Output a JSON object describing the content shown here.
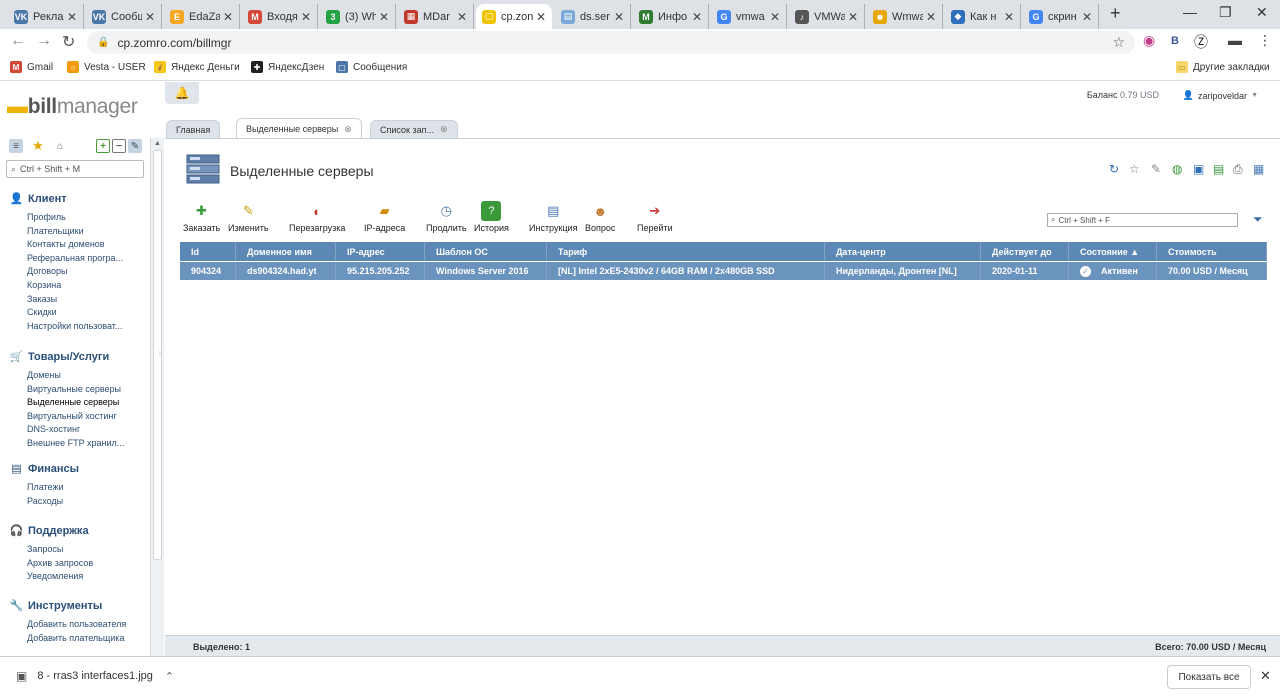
{
  "browser": {
    "tabs": [
      {
        "label": "Рекла",
        "fav": "VK",
        "color": "#4a76a8"
      },
      {
        "label": "Сообщ",
        "fav": "VK",
        "color": "#4a76a8"
      },
      {
        "label": "EdaZa",
        "fav": "E",
        "color": "#f5a623"
      },
      {
        "label": "Входя",
        "fav": "M",
        "color": "#d44638"
      },
      {
        "label": "(3) Wh",
        "fav": "3",
        "color": "#25a244"
      },
      {
        "label": "MDar",
        "fav": "▦",
        "color": "#c0392b"
      },
      {
        "label": "cp.zon",
        "fav": "▢",
        "color": "#f0c400"
      },
      {
        "label": "ds.ser",
        "fav": "▤",
        "color": "#7aa7d8"
      },
      {
        "label": "Инфо",
        "fav": "M",
        "color": "#2e7d32"
      },
      {
        "label": "vmwa",
        "fav": "G",
        "color": "#4285f4"
      },
      {
        "label": "VMWa",
        "fav": "♪",
        "color": "#555555"
      },
      {
        "label": "Wmwa",
        "fav": "☻",
        "color": "#e6a700"
      },
      {
        "label": "Как н",
        "fav": "◆",
        "color": "#2f6ebd"
      },
      {
        "label": "скрин",
        "fav": "G",
        "color": "#4285f4"
      }
    ],
    "url": "cp.zomro.com/billmgr",
    "bookmarks": [
      {
        "label": "Gmail",
        "fav": "M",
        "color": "#d44638"
      },
      {
        "label": "Vesta - USER",
        "fav": "○",
        "color": "#f39c12"
      },
      {
        "label": "Яндекс Деньги",
        "fav": "💰",
        "color": "#f5c518"
      },
      {
        "label": "ЯндексДзен",
        "fav": "✚",
        "color": "#222222"
      },
      {
        "label": "Сообщения",
        "fav": "▢",
        "color": "#4a76a8"
      }
    ],
    "other_bookmarks": "Другие закладки"
  },
  "app": {
    "logo_bill": "bill",
    "logo_manager": "manager",
    "balance_label": "Баланс",
    "balance_value": "0.79 USD",
    "username": "zaripoveldar",
    "sidebar_search_placeholder": "Ctrl + Shift + M",
    "sections": [
      {
        "title": "Клиент",
        "items": [
          "Профиль",
          "Плательщики",
          "Контакты доменов",
          "Реферальная програ...",
          "Договоры",
          "Корзина",
          "Заказы",
          "Скидки",
          "Настройки пользоват..."
        ]
      },
      {
        "title": "Товары/Услуги",
        "items": [
          "Домены",
          "Виртуальные серверы",
          "Выделенные серверы",
          "Виртуальный хостинг",
          "DNS-хостинг",
          "Внешнее FTP хранил..."
        ]
      },
      {
        "title": "Финансы",
        "items": [
          "Платежи",
          "Расходы"
        ]
      },
      {
        "title": "Поддержка",
        "items": [
          "Запросы",
          "Архив запросов",
          "Уведомления"
        ]
      },
      {
        "title": "Инструменты",
        "items": [
          "Добавить пользователя",
          "Добавить плательщика"
        ]
      }
    ],
    "app_tabs": [
      "Главная",
      "Выделенные серверы",
      "Список зап..."
    ],
    "page_title": "Выделенные серверы",
    "toolbar": [
      "Заказать",
      "Изменить",
      "Перезагрузка",
      "IP-адреса",
      "Продлить",
      "История",
      "Инструкция",
      "Вопрос",
      "Перейти"
    ],
    "filter_placeholder": "Ctrl + Shift + F",
    "columns": [
      "Id",
      "Доменное имя",
      "IP-адрес",
      "Шаблон ОС",
      "Тариф",
      "Дата-центр",
      "Действует до",
      "Состояние ▲",
      "Стоимость"
    ],
    "rows": [
      [
        "904324",
        "ds904324.had.yt",
        "95.215.205.252",
        "Windows Server 2016",
        "[NL] Intel 2xE5-2430v2 / 64GB RAM / 2x480GB SSD",
        "Нидерланды, Дронтен [NL]",
        "2020-01-11",
        "Активен",
        "70.00 USD / Месяц"
      ]
    ],
    "selected_label": "Выделено: 1",
    "total_label": "Всего: 70.00 USD / Месяц"
  },
  "download": {
    "filename": "8 - rras3 interfaces1.jpg",
    "show_all": "Показать все"
  }
}
